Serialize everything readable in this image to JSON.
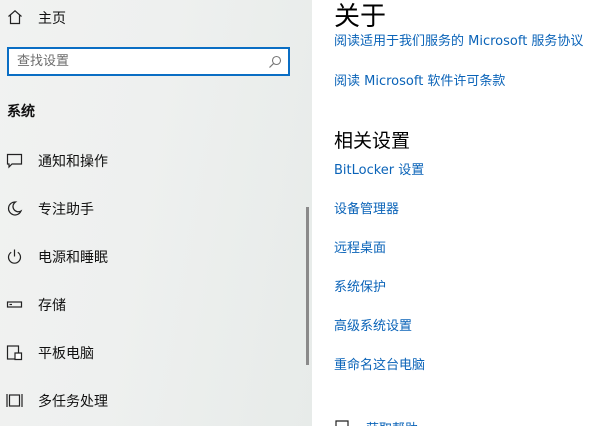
{
  "sidebar": {
    "home": {
      "label": "主页",
      "icon": "home-icon"
    },
    "search": {
      "placeholder": "查找设置",
      "icon": "search-icon"
    },
    "section_title": "系统",
    "items": [
      {
        "label": "通知和操作",
        "icon": "notification-icon"
      },
      {
        "label": "专注助手",
        "icon": "moon-icon"
      },
      {
        "label": "电源和睡眠",
        "icon": "power-icon"
      },
      {
        "label": "存储",
        "icon": "storage-icon"
      },
      {
        "label": "平板电脑",
        "icon": "tablet-icon"
      },
      {
        "label": "多任务处理",
        "icon": "multitasking-icon"
      }
    ]
  },
  "content": {
    "title": "关于",
    "clipped_link": "阅读适用于我们服务的 Microsoft 服务协议",
    "license_link": "阅读 Microsoft 软件许可条款",
    "related_heading": "相关设置",
    "related_links": [
      "BitLocker 设置",
      "设备管理器",
      "远程桌面",
      "系统保护",
      "高级系统设置",
      "重命名这台电脑"
    ],
    "help_link": {
      "label": "获取帮助",
      "icon": "help-chat-icon"
    }
  },
  "colors": {
    "accent": "#0a6ec4",
    "link": "#0a63b8",
    "sidebar_bg": "#eef0ef"
  }
}
